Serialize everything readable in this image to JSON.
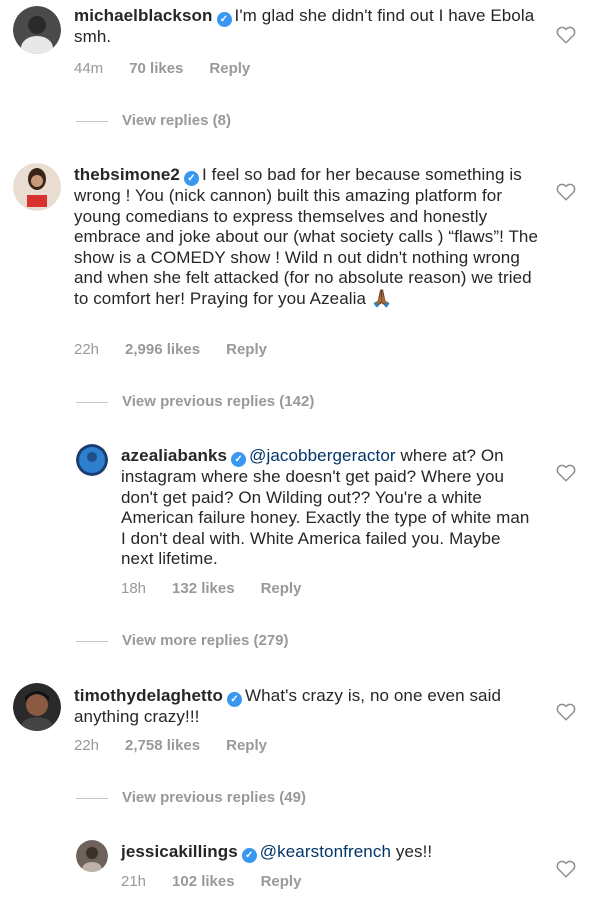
{
  "comments": [
    {
      "username": "michaelblackson",
      "text": "I'm glad she didn't find out I have Ebola smh.",
      "time": "44m",
      "likes": "70 likes",
      "reply": "Reply",
      "view_replies": "View replies (8)",
      "avatar_colors": [
        "#5a5a5a",
        "#2b2b2b"
      ]
    },
    {
      "username": "thebsimone2",
      "text": "I feel so bad for her because something is wrong ! You (nick cannon) built this amazing platform for young comedians to express themselves and honestly embrace and joke about our (what society calls ) “flaws”! The show is a COMEDY show ! Wild n out didn't nothing wrong and when she felt attacked (for no absolute reason) we tried to comfort her! Praying for you Azealia",
      "emoji": "🙏🏾",
      "time": "22h",
      "likes": "2,996 likes",
      "reply": "Reply",
      "view_replies": "View previous replies (142)",
      "avatar_colors": [
        "#c9a68d",
        "#d8322e"
      ]
    },
    {
      "username": "azealiabanks",
      "mention": "@jacobbergeractor",
      "text": " where at? On instagram where she doesn't get paid? Where you don't get paid? On Wilding out?? You're a white American failure honey. Exactly the type of white man I don't deal with. White America failed you. Maybe next lifetime.",
      "time": "18h",
      "likes": "132 likes",
      "reply": "Reply",
      "view_replies": "View more replies (279)",
      "avatar_colors": [
        "#2f7fd0",
        "#1a3d6e"
      ]
    },
    {
      "username": "timothydelaghetto",
      "text": "What's crazy is, no one even said anything crazy!!!",
      "time": "22h",
      "likes": "2,758 likes",
      "reply": "Reply",
      "view_replies": "View previous replies (49)",
      "avatar_colors": [
        "#6b4a3a",
        "#222222"
      ]
    },
    {
      "username": "jessicakillings",
      "mention": "@kearstonfrench",
      "text": " yes!!",
      "time": "21h",
      "likes": "102 likes",
      "reply": "Reply",
      "avatar_colors": [
        "#8a7a70",
        "#3a302a"
      ]
    }
  ],
  "colors": {
    "text": "#262626",
    "muted": "#999999",
    "mention": "#003569",
    "verified": "#3897f0"
  }
}
